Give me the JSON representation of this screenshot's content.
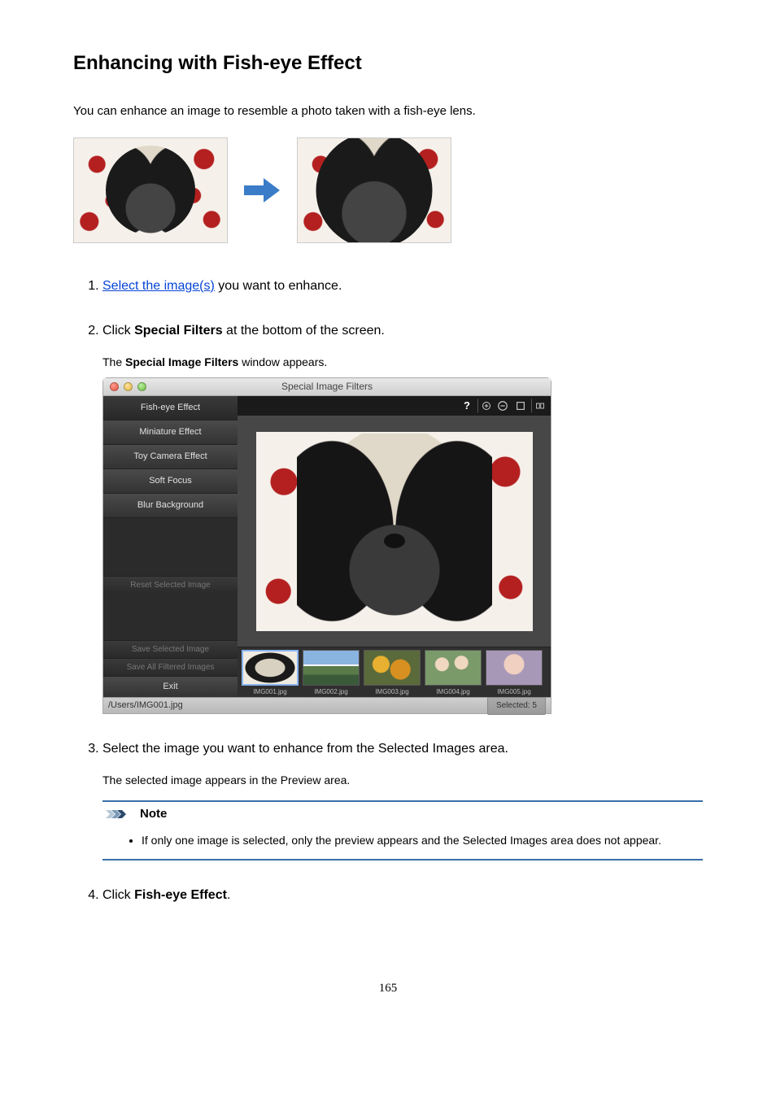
{
  "heading": "Enhancing with Fish-eye Effect",
  "intro": "You can enhance an image to resemble a photo taken with a fish-eye lens.",
  "steps": {
    "s1": {
      "link": "Select the image(s)",
      "tail": " you want to enhance."
    },
    "s2": {
      "prefix": "Click ",
      "term": "Special Filters",
      "suffix": " at the bottom of the screen.",
      "sub_prefix": "The ",
      "sub_term": "Special Image Filters",
      "sub_suffix": " window appears."
    },
    "s3": {
      "text": "Select the image you want to enhance from the Selected Images area.",
      "sub": "The selected image appears in the Preview area."
    },
    "s4": {
      "prefix": "Click ",
      "term": "Fish-eye Effect",
      "suffix": "."
    }
  },
  "note": {
    "label": "Note",
    "bullet": "If only one image is selected, only the preview appears and the Selected Images area does not appear."
  },
  "window": {
    "title": "Special Image Filters",
    "sidebar": {
      "fisheye": "Fish-eye Effect",
      "miniature": "Miniature Effect",
      "toycam": "Toy Camera Effect",
      "softfocus": "Soft Focus",
      "blurbg": "Blur Background",
      "reset": "Reset Selected Image",
      "save": "Save Selected Image",
      "saveall": "Save All Filtered Images",
      "exit": "Exit"
    },
    "thumbs": [
      "IMG001.jpg",
      "IMG002.jpg",
      "IMG003.jpg",
      "IMG004.jpg",
      "IMG005.jpg"
    ],
    "status_path": "/Users/IMG001.jpg",
    "status_selected": "Selected: 5"
  },
  "page_number": "165"
}
